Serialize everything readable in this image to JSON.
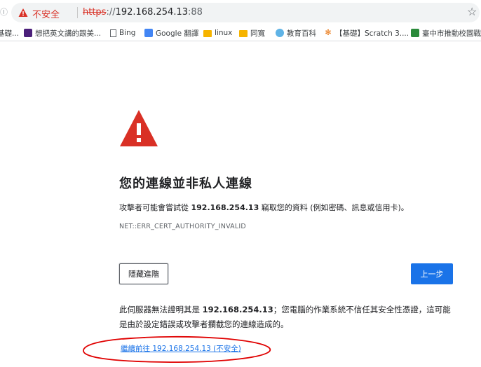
{
  "browser": {
    "left_edge_glyph": "Ⓘ",
    "security_label": "不安全",
    "url_protocol": "https",
    "url_separator": "://",
    "url_host": "192.168.254.13",
    "url_port": ":88"
  },
  "bookmarks": [
    {
      "label": "基礎...",
      "icon": "partial-item-icon"
    },
    {
      "label": "想把英文講的跟美...",
      "icon": "video-site-icon"
    },
    {
      "label": "Bing",
      "icon": "page-icon"
    },
    {
      "label": "Google 翻譯",
      "icon": "google-translate-icon"
    },
    {
      "label": "linux",
      "icon": "folder-icon"
    },
    {
      "label": "同寬",
      "icon": "folder-icon"
    },
    {
      "label": "教育百科",
      "icon": "edu-site-icon"
    },
    {
      "label": "【基礎】Scratch 3....",
      "icon": "scratch-site-icon"
    },
    {
      "label": "臺中市推動校園戰...",
      "icon": "taichung-site-icon"
    }
  ],
  "interstitial": {
    "heading": "您的連線並非私人連線",
    "body_prefix": "攻擊者可能會嘗試從 ",
    "body_host": "192.168.254.13",
    "body_suffix": " 竊取您的資料 (例如密碼、訊息或信用卡)。",
    "error_code": "NET::ERR_CERT_AUTHORITY_INVALID",
    "advanced_button": "隱藏進階",
    "back_button": "上一步",
    "detail_prefix": "此伺服器無法證明其是 ",
    "detail_host": "192.168.254.13",
    "detail_suffix": "；您電腦的作業系統不信任其安全性憑證，這可能是由於設定錯誤或攻擊者攔截您的連線造成的。",
    "proceed_link": "繼續前往 192.168.254.13 (不安全)"
  },
  "colors": {
    "warning_red": "#d93025",
    "primary_blue": "#1a73e8",
    "annotation_red": "#e00000"
  }
}
